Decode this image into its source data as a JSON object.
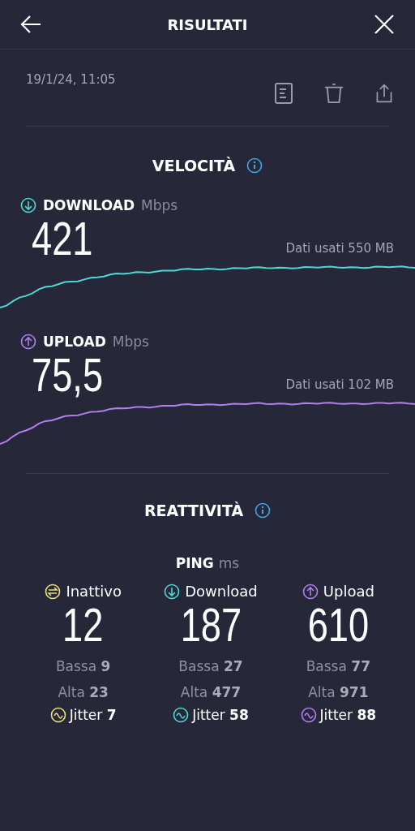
{
  "header": {
    "title": "RISULTATI"
  },
  "date": "19/1/24, 11:05",
  "speed": {
    "title": "VELOCITÀ",
    "tests": [
      {
        "kind": "download",
        "label": "DOWNLOAD",
        "unit": "Mbps",
        "value": "421",
        "data_used": "Dati usati 550 MB",
        "color": "#4fd8d2"
      },
      {
        "kind": "upload",
        "label": "UPLOAD",
        "unit": "Mbps",
        "value": "75,5",
        "data_used": "Dati usati 102 MB",
        "color": "#b27ff0"
      }
    ]
  },
  "responsiveness": {
    "title": "REATTIVITÀ",
    "ping_label": "PING",
    "ping_unit": "ms",
    "columns": [
      {
        "kind": "idle",
        "label": "Inattivo",
        "value": "12",
        "low": "Bassa **9**",
        "high": "Alta **23**",
        "jitter": "Jitter **7**",
        "color": "#e9e27c"
      },
      {
        "kind": "download",
        "label": "Download",
        "value": "187",
        "low": "Bassa **27**",
        "high": "Alta **477**",
        "jitter": "Jitter **58**",
        "color": "#4fd8d2"
      },
      {
        "kind": "upload",
        "label": "Upload",
        "value": "610",
        "low": "Bassa **77**",
        "high": "Alta **971**",
        "jitter": "Jitter **88**",
        "color": "#b27ff0"
      }
    ]
  }
}
